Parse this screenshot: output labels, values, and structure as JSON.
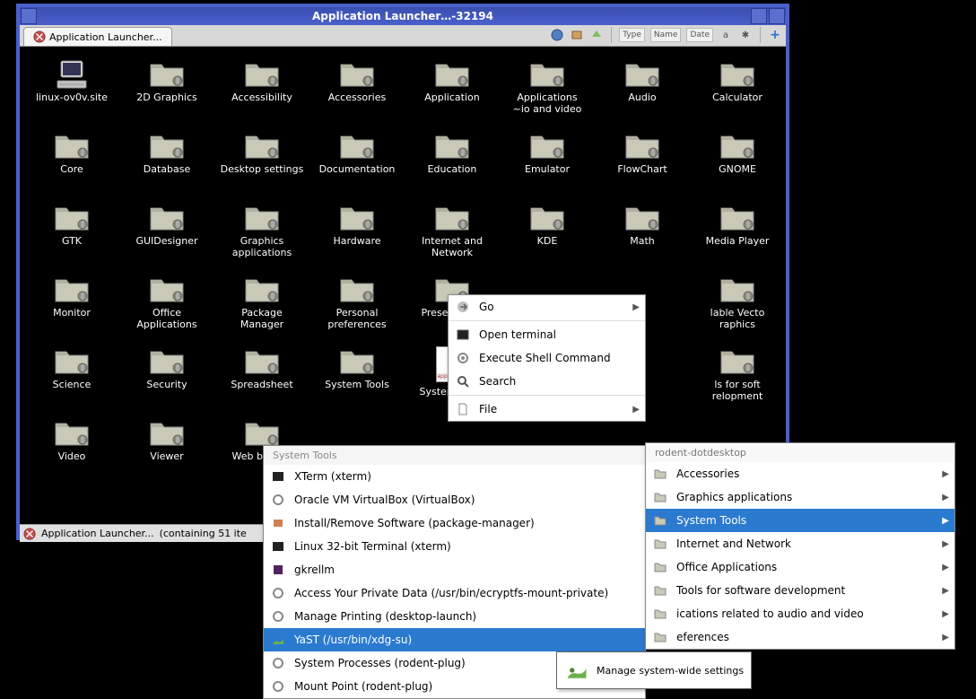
{
  "window": {
    "title": "Application Launcher…-32194",
    "tab": "Application Launcher...",
    "status_prefix": "Application Launcher...",
    "status_text": "(containing 51 ite",
    "toolbar": {
      "type": "Type",
      "name": "Name",
      "date": "Date"
    }
  },
  "icons": [
    {
      "label": "linux-ov0v.site",
      "type": "computer"
    },
    {
      "label": "2D Graphics"
    },
    {
      "label": "Accessibility"
    },
    {
      "label": "Accessories"
    },
    {
      "label": "Application"
    },
    {
      "label": "Applications",
      "sub": "~io and video"
    },
    {
      "label": "Audio"
    },
    {
      "label": "Calculator"
    },
    {
      "label": "Core"
    },
    {
      "label": "Database"
    },
    {
      "label": "Desktop settings"
    },
    {
      "label": "Documentation"
    },
    {
      "label": "Education"
    },
    {
      "label": "Emulator"
    },
    {
      "label": "FlowChart"
    },
    {
      "label": "GNOME"
    },
    {
      "label": "GTK"
    },
    {
      "label": "GUIDesigner"
    },
    {
      "label": "Graphics applications"
    },
    {
      "label": "Hardware"
    },
    {
      "label": "Internet and Network"
    },
    {
      "label": "KDE"
    },
    {
      "label": "Math"
    },
    {
      "label": "Media Player"
    },
    {
      "label": "Monitor"
    },
    {
      "label": "Office Applications"
    },
    {
      "label": "Package Manager"
    },
    {
      "label": "Personal preferences"
    },
    {
      "label": "Presentation"
    },
    {
      "label": "lable Vecto raphics",
      "partial": true
    },
    {
      "label": "Science"
    },
    {
      "label": "Security"
    },
    {
      "label": "Spreadsheet"
    },
    {
      "label": "System Tools"
    },
    {
      "label": "SystemSetup",
      "type": "file"
    },
    {
      "label": "ls for soft relopment",
      "partial": true
    },
    {
      "label": "Video",
      "partial": true
    },
    {
      "label": "Viewer"
    },
    {
      "label": "Web browse",
      "partial": true
    }
  ],
  "ctx_main": {
    "go": "Go",
    "open_terminal": "Open terminal",
    "exec_shell": "Execute Shell Command",
    "search": "Search",
    "file": "File"
  },
  "submenu": {
    "header": "System Tools",
    "items": [
      "XTerm (xterm)",
      "Oracle VM VirtualBox (VirtualBox)",
      "Install/Remove Software (package-manager)",
      "Linux 32-bit Terminal (xterm)",
      "gkrellm",
      "Access Your Private Data (/usr/bin/ecryptfs-mount-private)",
      "Manage Printing (desktop-launch)",
      "YaST (/usr/bin/xdg-su)",
      "System Processes (rodent-plug)",
      "Mount Point (rodent-plug)"
    ],
    "selected_index": 7
  },
  "side": {
    "title": "rodent-dotdesktop",
    "items": [
      "Accessories",
      "Graphics applications",
      "System Tools",
      "Internet and Network",
      "Office Applications",
      "Tools for software development",
      "ications related to audio and video",
      "eferences"
    ],
    "selected_index": 2
  },
  "tooltip": "Manage system-wide settings"
}
